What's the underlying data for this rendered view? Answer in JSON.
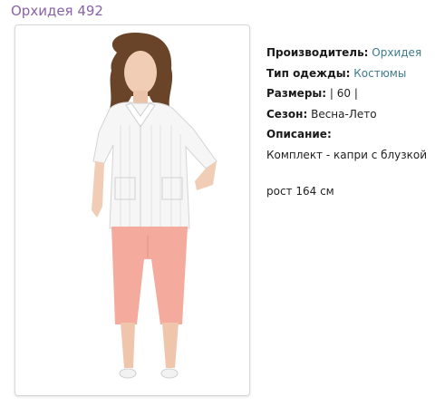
{
  "product": {
    "title": "Орхидея 492",
    "image_alt": "model-photo"
  },
  "details": {
    "manufacturer_label": "Производитель:",
    "manufacturer_value": "Орхидея",
    "clothing_type_label": "Тип одежды:",
    "clothing_type_value": "Костюмы",
    "sizes_label": "Размеры:",
    "sizes_value": "| 60 |",
    "season_label": "Сезон:",
    "season_value": "Весна-Лето",
    "description_label": "Описание:",
    "description_text": "Комплект - капри с блузкой",
    "height_text": "рост 164 см"
  },
  "colors": {
    "title": "#8a63a8",
    "link": "#3d7a8c",
    "blouse": "#f4f4f4",
    "pants": "#f2a89a"
  }
}
